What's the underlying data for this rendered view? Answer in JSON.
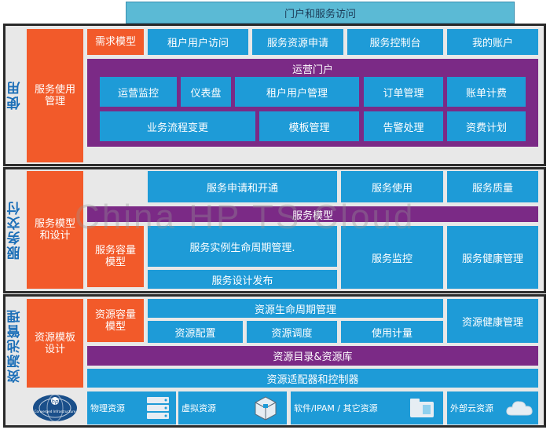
{
  "top_bar": "门户和服务访问",
  "layers": {
    "usage": {
      "label": "使用",
      "left": "服务使用管理",
      "demand_model": "需求模型",
      "row1": [
        "租户用户访问",
        "服务资源申请",
        "服务控制台",
        "我的账户"
      ],
      "portal_title": "运营门户",
      "portal_row1": [
        "运营监控",
        "仪表盘",
        "租户用户管理",
        "订单管理",
        "账单计费"
      ],
      "portal_row2": [
        "业务流程变更",
        "模板管理",
        "告警处理",
        "资费计划"
      ]
    },
    "delivery": {
      "label": "服务交付",
      "left": "服务模型和设计",
      "row1": [
        "服务申请和开通",
        "服务使用",
        "服务质量"
      ],
      "service_model_bar": "服务模型",
      "capacity_model": "服务容量模型",
      "instance_lifecycle": "服务实例生命周期管理.",
      "design_publish": "服务设计发布",
      "monitor": "服务监控",
      "health": "服务健康管理"
    },
    "pool": {
      "label": "资源池管理",
      "left": "资源模板设计",
      "capacity_model": "资源容量模型",
      "lifecycle": "资源生命周期管理",
      "row2": [
        "资源配置",
        "资源调度",
        "使用计量"
      ],
      "health": "资源健康管理",
      "catalog_bar": "资源目录&资源库",
      "adapter_bar": "资源适配器和控制器"
    }
  },
  "bottom_row": [
    "物理资源",
    "虚拟资源",
    "软件/IPAM / 其它资源",
    "外部云资源"
  ],
  "logo_text": "Converged Infrastructure",
  "watermark": "China HP TS Cloud",
  "colors": {
    "blue": "#1e9bd7",
    "orange": "#f25a2a",
    "purple": "#7b2a86",
    "label_blue": "#1c6fb8"
  }
}
